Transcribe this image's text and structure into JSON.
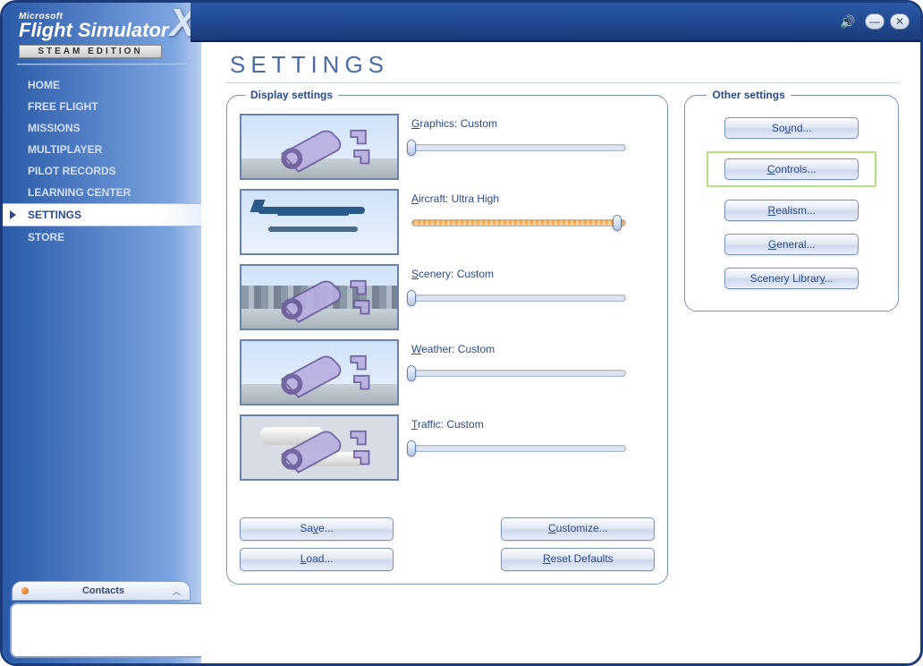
{
  "logo": {
    "small": "Microsoft",
    "main": "Flight Simulator",
    "x": "X",
    "edition": "STEAM EDITION"
  },
  "nav": {
    "items": [
      {
        "label": "HOME"
      },
      {
        "label": "FREE FLIGHT"
      },
      {
        "label": "MISSIONS"
      },
      {
        "label": "MULTIPLAYER"
      },
      {
        "label": "PILOT RECORDS"
      },
      {
        "label": "LEARNING CENTER"
      },
      {
        "label": "SETTINGS"
      },
      {
        "label": "STORE"
      }
    ],
    "active_index": 6
  },
  "contacts": {
    "label": "Contacts"
  },
  "page": {
    "title": "SETTINGS"
  },
  "display_panel": {
    "legend": "Display settings",
    "rows": [
      {
        "label_hot": "G",
        "label_rest": "raphics:",
        "value": "Custom",
        "knob_pct": 0,
        "orange": false
      },
      {
        "label_hot": "A",
        "label_rest": "ircraft:",
        "value": "Ultra High",
        "knob_pct": 96,
        "orange": true
      },
      {
        "label_hot": "S",
        "label_rest": "cenery:",
        "value": "Custom",
        "knob_pct": 0,
        "orange": false
      },
      {
        "label_hot": "W",
        "label_rest": "eather:",
        "value": "Custom",
        "knob_pct": 0,
        "orange": false
      },
      {
        "label_hot": "T",
        "label_rest": "raffic:",
        "value": "Custom",
        "knob_pct": 0,
        "orange": false
      }
    ],
    "buttons": {
      "save": {
        "hot": "v",
        "pre": "Sa",
        "post": "e..."
      },
      "customize": {
        "hot": "C",
        "pre": "",
        "post": "ustomize..."
      },
      "load": {
        "hot": "L",
        "pre": "",
        "post": "oad..."
      },
      "reset": {
        "hot": "R",
        "pre": "",
        "post": "eset Defaults"
      }
    }
  },
  "other_panel": {
    "legend": "Other settings",
    "buttons": [
      {
        "name": "sound",
        "hot": "u",
        "pre": "So",
        "post": "nd..."
      },
      {
        "name": "controls",
        "hot": "C",
        "pre": "",
        "post": "ontrols...",
        "highlight": true
      },
      {
        "name": "realism",
        "hot": "R",
        "pre": "",
        "post": "ealism..."
      },
      {
        "name": "general",
        "hot": "G",
        "pre": "",
        "post": "eneral..."
      },
      {
        "name": "scenery-library",
        "hot": "y",
        "pre": "Scenery Librar",
        "post": "..."
      }
    ]
  }
}
